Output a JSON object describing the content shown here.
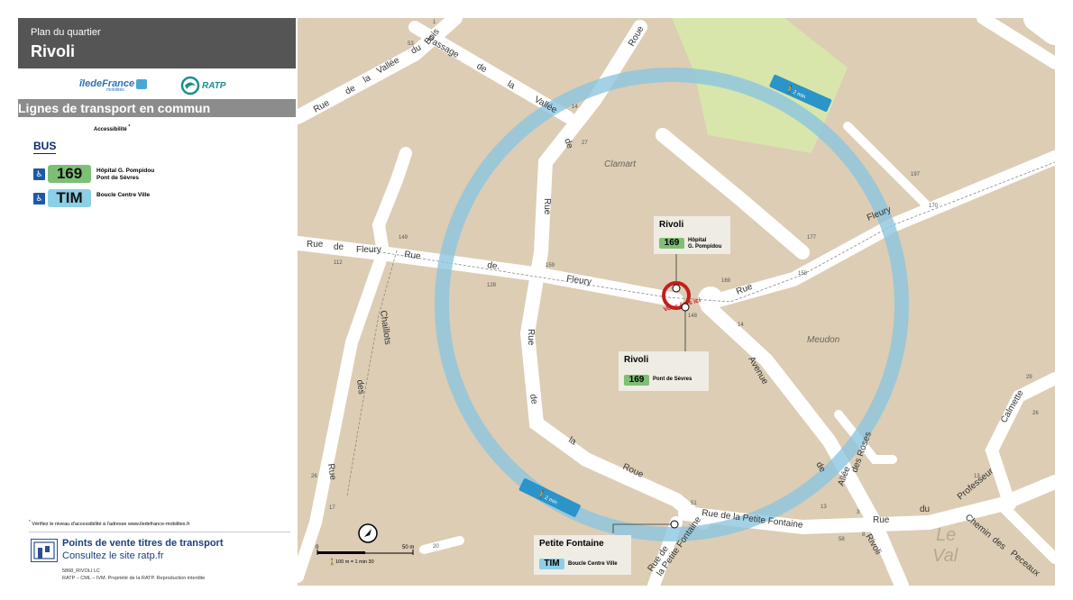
{
  "header": {
    "subtitle": "Plan du quartier",
    "title": "Rivoli"
  },
  "logos": {
    "idf": "îledeFrance",
    "idf_sub": "mobilités",
    "ratp": "RATP"
  },
  "lines_section": {
    "title": "Lignes de transport en commun",
    "accessibility_label": "Accessibilité",
    "accessibility_mark": "*",
    "mode": "BUS",
    "lines": [
      {
        "code": "169",
        "color": "#7dbf75",
        "dest1": "Hôpital G. Pompidou",
        "dest2": "Pont de Sèvres",
        "pmr_icon": "wheelchair-icon"
      },
      {
        "code": "TIM",
        "color": "#8ccfe6",
        "dest1": "Boucle Centre Ville",
        "dest2": "",
        "pmr_icon": "wheelchair-icon"
      }
    ]
  },
  "footer": {
    "note_mark": "*",
    "note": "Vérifiez le niveau d'accessibilité à l'adresse www.iledefrance-mobilites.fr",
    "sales_title": "Points de vente titres de transport",
    "sales_sub": "Consultez le site ratp.fr",
    "ref": "5868_RIVOLI LC",
    "copyright": "RATP – CML – IVM. Propriété de la RATP. Reproduction interdite"
  },
  "map": {
    "colors": {
      "background": "#dccdb4",
      "road": "#ffffff",
      "park": "#d8e6ab",
      "walk_ring": "#8cc6e0",
      "you_are_here": "#c41e1e"
    },
    "walk_time": "2 min",
    "you_are_here": "Vous êtes ici",
    "areas": [
      "Clamart",
      "Meudon"
    ],
    "district": [
      "Le",
      "Val"
    ],
    "streets": {
      "vallee_rue": "Rue",
      "vallee_de": "de",
      "vallee_la": "la",
      "vallee_name": "Vallée",
      "vallee_du": "du",
      "vallee_bois": "Bois",
      "passage": "Passage",
      "passage_de": "de",
      "passage_la": "la",
      "passage_vallee": "Vallée",
      "roue_v1": "Rue",
      "roue_v2": "de",
      "roue_v3": "la",
      "roue_v4": "Roue",
      "roue_top": "Roue",
      "fleury_rue": "Rue",
      "fleury_de": "de",
      "fleury_name": "Fleury",
      "fleury_rue2": "Rue",
      "fleury_de2": "de.",
      "fleury_name2": "Fleury",
      "fleury_rue3": "Rue",
      "fleury_name3": "Fleury",
      "chaillots_name": "Chaillots",
      "chaillots_des": "des",
      "chaillots_rue": "Rue",
      "roue_bottom_de": "de",
      "roue_bottom_la": "la",
      "roue_bottom_name": "Roue",
      "avenue": "Avenue",
      "de_rivoli": "de",
      "rivoli": "Rivoli",
      "allee": "Allée",
      "des_roses": "des Roses",
      "petite_fontaine": "Rue   de   la   Petite   Fontaine",
      "petite_fontaine_v1": "Rue de",
      "petite_fontaine_v2": "la Petite Fontaine",
      "rue_du": "Rue",
      "du": "du",
      "professeur": "Professeur",
      "calmette": "Calmette",
      "chemin": "Chemin",
      "des": "des",
      "peceaux": "Peceaux"
    },
    "house_numbers": [
      "1",
      "53",
      "14",
      "27",
      "197",
      "170",
      "177",
      "149",
      "112",
      "159",
      "128",
      "169",
      "148",
      "158",
      "14",
      "13",
      "29",
      "26",
      "13",
      "3",
      "58",
      "8",
      "51",
      "20",
      "17",
      "26"
    ],
    "stops": [
      {
        "name": "Rivoli",
        "line": "169",
        "dest1": "Hôpital",
        "dest2": "G. Pompidou"
      },
      {
        "name": "Rivoli",
        "line": "169",
        "dest1": "Pont de Sèvres",
        "dest2": ""
      },
      {
        "name": "Petite Fontaine",
        "line": "TIM",
        "dest1": "Boucle Centre Ville",
        "dest2": ""
      }
    ],
    "scale": {
      "start": "0",
      "end": "50 m",
      "legend": "100 m = 1 min 30"
    }
  }
}
